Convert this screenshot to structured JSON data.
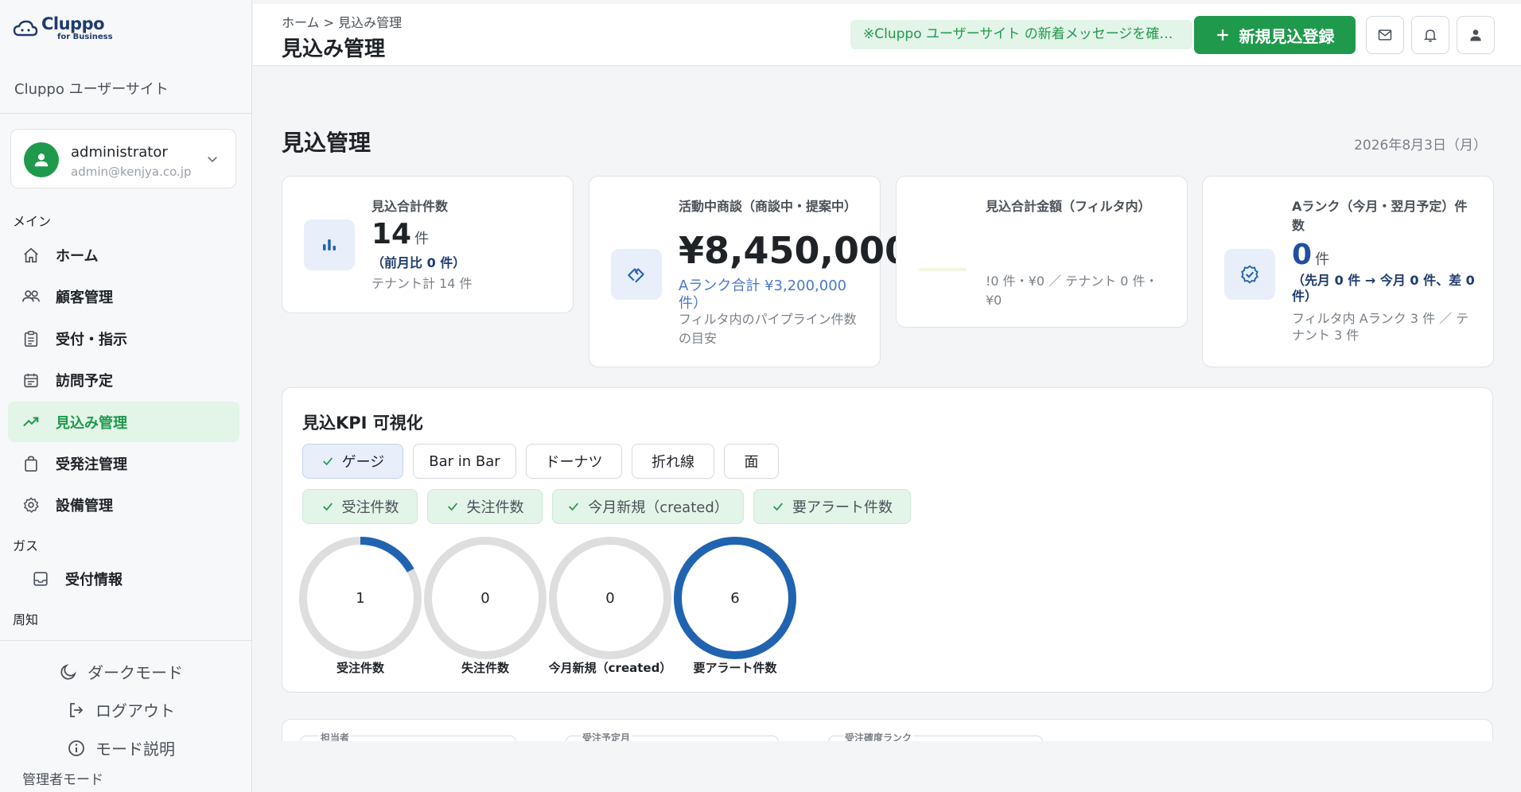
{
  "sidebar": {
    "logo_main": "Cluppo",
    "logo_sub": "for Business",
    "site_name": "Cluppo ユーザーサイト",
    "user": {
      "name": "administrator",
      "email": "admin@kenjya.co.jp"
    },
    "sections": {
      "main": "メイン",
      "gas": "ガス",
      "notice": "周知"
    },
    "items": [
      {
        "label": "ホーム",
        "icon": "home-icon"
      },
      {
        "label": "顧客管理",
        "icon": "users-icon"
      },
      {
        "label": "受付・指示",
        "icon": "clipboard-icon"
      },
      {
        "label": "訪問予定",
        "icon": "calendar-icon"
      },
      {
        "label": "見込み管理",
        "icon": "trending-up-icon",
        "active": true
      },
      {
        "label": "受発注管理",
        "icon": "shopping-bag-icon"
      },
      {
        "label": "設備管理",
        "icon": "gear-icon"
      }
    ],
    "gas_items": [
      {
        "label": "受付情報",
        "icon": "inbox-icon"
      }
    ],
    "bottom": {
      "dark_mode": "ダークモード",
      "logout": "ログアウト",
      "mode_help": "モード説明",
      "admin_mode": "管理者モード"
    }
  },
  "header": {
    "breadcrumb": "ホーム > 見込み管理",
    "title": "見込み管理",
    "notice": "※Cluppo ユーザーサイト の新着メッセージを確認してください",
    "new_button": "新規見込登録",
    "accent": "#1f9a4c"
  },
  "main": {
    "title": "見込管理",
    "date": "2026年8月3日（月）",
    "kpis": [
      {
        "label": "見込合計件数",
        "value": "14",
        "unit": "件",
        "sub1": "（前月比 0 件）",
        "sub2": "テナント計 14 件",
        "icon": "bar-chart-icon"
      },
      {
        "label": "活動中商談（商談中・提案中）",
        "value": "¥8,450,000",
        "sub1": "Aランク合計 ¥3,200,000 件）",
        "sub2": "フィルタ内のパイプライン件数の目安",
        "icon": "handshake-icon"
      },
      {
        "label": "見込合計金額（フィルタ内）",
        "sub1": "!0 件・¥0 ／ テナント 0 件・¥0",
        "icon": "yen-icon"
      },
      {
        "label": "Aランク（今月・翌月予定）件数",
        "value": "0",
        "unit": "件",
        "sub1": "（先月 0 件 → 今月 0 件、差 0 件）",
        "sub2": "フィルタ内 Aランク 3 件 ／ テナント 3 件",
        "icon": "badge-check-icon"
      }
    ],
    "kpi_panel": {
      "title": "見込KPI 可視化",
      "chart_types": [
        "ゲージ",
        "Bar in Bar",
        "ドーナツ",
        "折れ線",
        "面"
      ],
      "selected_type": "ゲージ",
      "metrics": [
        "受注件数",
        "失注件数",
        "今月新規（created）",
        "要アラート件数"
      ]
    },
    "filters": {
      "owner": "担当者",
      "order_month": "受注予定月",
      "rank": "受注確度ランク"
    }
  },
  "chart_data": {
    "type": "gauge",
    "categories": [
      "受注件数",
      "失注件数",
      "今月新規（created）",
      "要アラート件数"
    ],
    "values": [
      1,
      0,
      0,
      6
    ],
    "fill_fraction": [
      0.17,
      0,
      0,
      1.0
    ],
    "track_color": "#dedede",
    "fill_color": "#2063b0"
  }
}
